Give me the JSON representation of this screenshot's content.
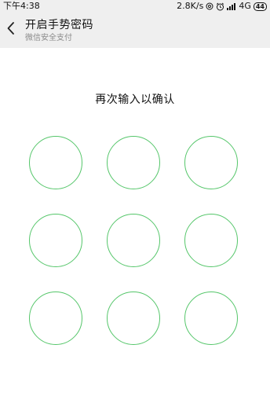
{
  "status_bar": {
    "time": "下午4:38",
    "speed": "2.8K/s",
    "network": "4G",
    "battery": "44",
    "icons": [
      "no-disturb-icon",
      "alarm-icon",
      "signal-icon",
      "network-4g-icon",
      "battery-icon"
    ]
  },
  "header": {
    "back_icon": "chevron-left-icon",
    "title": "开启手势密码",
    "subtitle": "微信安全支付"
  },
  "main": {
    "prompt": "再次输入以确认",
    "pattern_dot_count": 9,
    "dot_color": "#55c66a"
  },
  "colors": {
    "header_bg": "#efefef",
    "page_bg": "#ffffff",
    "accent": "#55c66a"
  }
}
